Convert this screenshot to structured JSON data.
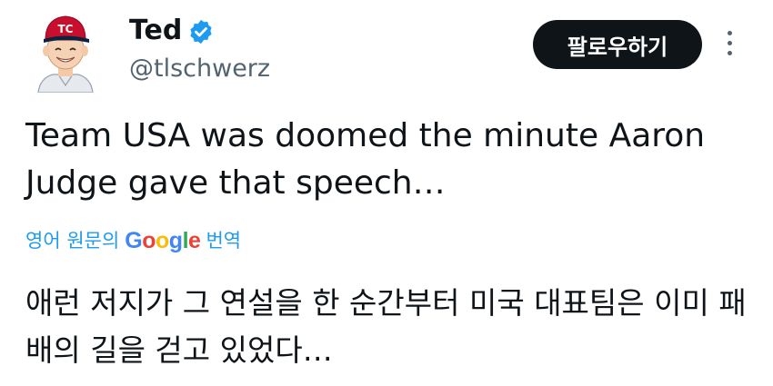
{
  "author": {
    "display_name": "Ted",
    "handle": "@tlschwerz"
  },
  "actions": {
    "follow_label": "팔로우하기"
  },
  "tweet": {
    "text": "Team USA was doomed the minute Aaron Judge gave that speech…"
  },
  "translation": {
    "prefix": "영어 원문의",
    "suffix": "번역",
    "translated_text": "애런 저지가 그 연설을 한 순간부터 미국 대표팀은 이미 패배의 길을 걷고 있었다…"
  },
  "icons": {
    "verified": "verified-badge-icon",
    "more": "more-vertical-icon"
  },
  "colors": {
    "accent": "#1d9bf0",
    "follow_bg": "#0f1419",
    "secondary_text": "#536471"
  }
}
